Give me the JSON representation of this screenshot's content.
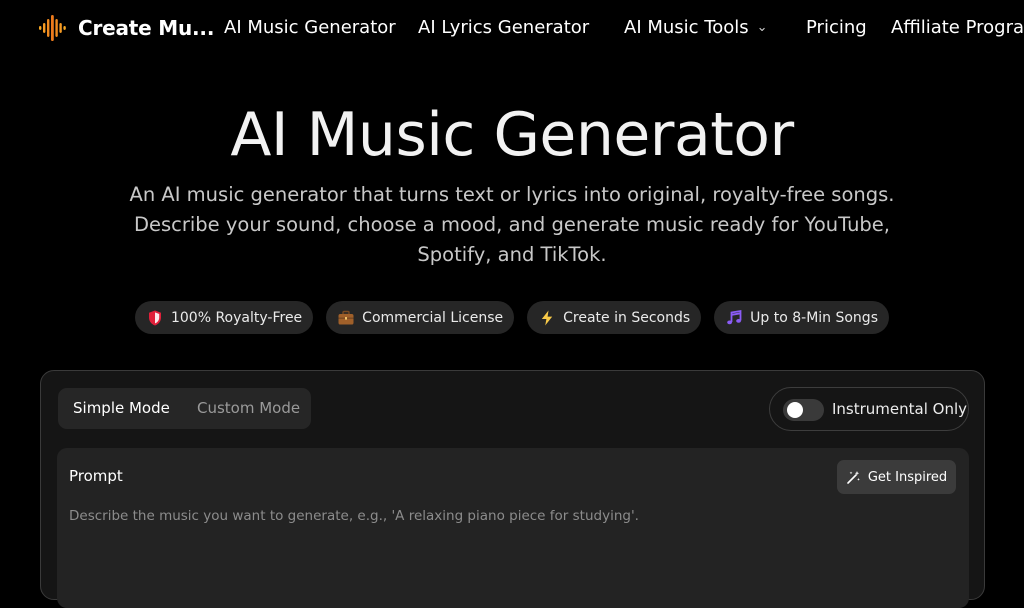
{
  "nav": {
    "brand": "Create Mu...",
    "links": {
      "music_generator": "AI Music Generator",
      "lyrics_generator": "AI Lyrics Generator",
      "music_tools": "AI Music Tools",
      "pricing": "Pricing",
      "affiliate": "Affiliate Progra"
    },
    "chevron": "⌄"
  },
  "hero": {
    "title": "AI Music Generator",
    "description": "An AI music generator that turns text or lyrics into original, royalty-free songs. Describe your sound, choose a mood, and generate music ready for YouTube, Spotify, and TikTok."
  },
  "badges": [
    {
      "icon": "shield-icon",
      "label": "100% Royalty-Free"
    },
    {
      "icon": "briefcase-icon",
      "label": "Commercial License"
    },
    {
      "icon": "lightning-icon",
      "label": "Create in Seconds"
    },
    {
      "icon": "music-note-icon",
      "label": "Up to 8-Min Songs"
    }
  ],
  "panel": {
    "modes": {
      "simple": "Simple Mode",
      "custom": "Custom Mode",
      "selected": "Simple Mode"
    },
    "instrumental": {
      "label": "Instrumental Only",
      "enabled": false
    },
    "prompt": {
      "label": "Prompt",
      "inspire_label": "Get Inspired",
      "value": "",
      "placeholder": "Describe the music you want to generate, e.g., 'A relaxing piano piece for studying'."
    }
  },
  "colors": {
    "background": "#000000",
    "panel": "#151515",
    "badge": "#262626",
    "accent_orange": "#f5a623",
    "accent_red": "#e0203a",
    "accent_purple": "#8b5cf6",
    "accent_yellow": "#f7c948"
  }
}
